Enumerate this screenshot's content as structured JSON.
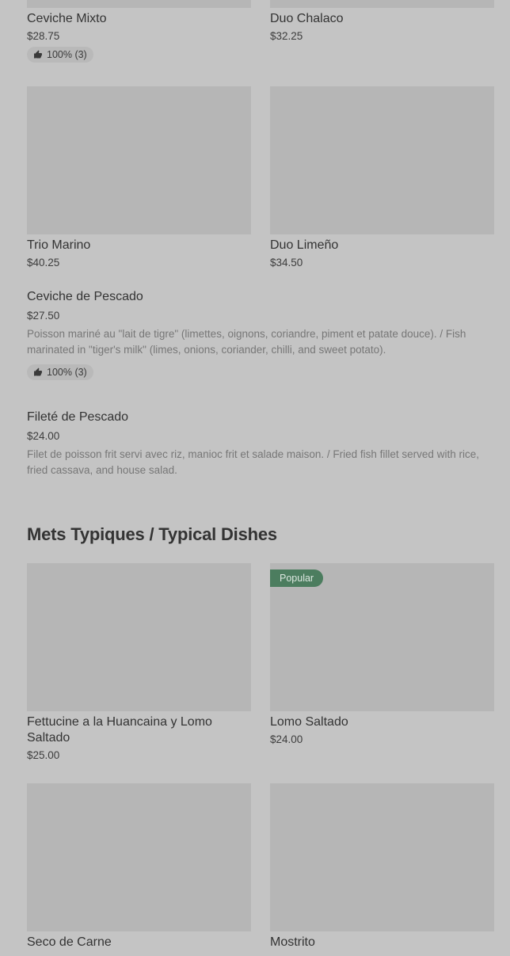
{
  "items_top": [
    {
      "name": "Ceviche Mixto",
      "price": "$28.75",
      "rating": "100% (3)"
    },
    {
      "name": "Duo Chalaco",
      "price": "$32.25"
    },
    {
      "name": "Trio Marino",
      "price": "$40.25"
    },
    {
      "name": "Duo Limeño",
      "price": "$34.50"
    }
  ],
  "list_items": [
    {
      "name": "Ceviche de Pescado",
      "price": "$27.50",
      "description": "Poisson mariné au \"lait de tigre\" (limettes, oignons, coriandre, piment et patate douce). / Fish marinated in \"tiger's milk\" (limes, onions, coriander, chilli, and sweet potato).",
      "rating": "100% (3)"
    },
    {
      "name": "Fileté de Pescado",
      "price": "$24.00",
      "description": "Filet de poisson frit servi avec riz, manioc frit et salade maison. / Fried fish fillet served with rice, fried cassava, and house salad."
    }
  ],
  "section": {
    "title": "Mets Typiques / Typical Dishes"
  },
  "typical_items": [
    {
      "name": "Fettucine a la Huancaina y Lomo Saltado",
      "price": "$25.00"
    },
    {
      "name": "Lomo Saltado",
      "price": "$24.00",
      "tag": "Popular"
    },
    {
      "name": "Seco de Carne"
    },
    {
      "name": "Mostrito"
    }
  ],
  "icons": {
    "rating": "thumbs-up-icon"
  }
}
